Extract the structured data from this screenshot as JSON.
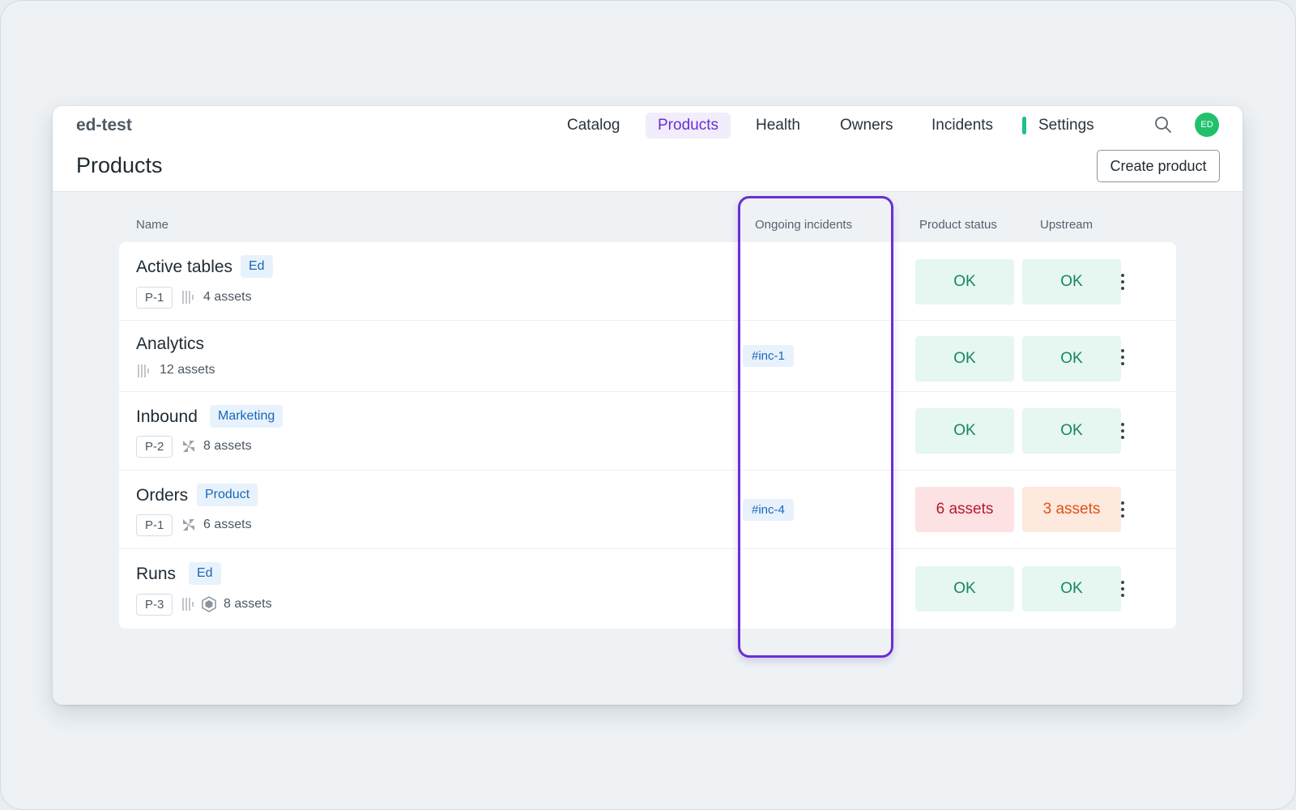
{
  "app": {
    "brand": "ed-test",
    "page_title": "Products"
  },
  "nav": {
    "items": [
      "Catalog",
      "Products",
      "Health",
      "Owners",
      "Incidents",
      "Settings"
    ],
    "active": "Products",
    "settings_indicator_color": "#1fbf8f"
  },
  "user": {
    "initials": "ED",
    "avatar_color": "#22c06b"
  },
  "toolbar": {
    "create_label": "Create product"
  },
  "table": {
    "columns": {
      "name": "Name",
      "incidents": "Ongoing incidents",
      "status": "Product status",
      "upstream": "Upstream"
    },
    "rows": [
      {
        "name": "Active tables",
        "tag": "Ed",
        "code": "P-1",
        "source_icons": [
          "table-icon"
        ],
        "assets": "4 assets",
        "incident": "",
        "status": "OK",
        "status_level": "ok",
        "upstream": "OK",
        "upstream_level": "ok"
      },
      {
        "name": "Analytics",
        "tag": "",
        "code": "",
        "source_icons": [
          "table-icon"
        ],
        "assets": "12 assets",
        "incident": "#inc-1",
        "status": "OK",
        "status_level": "ok",
        "upstream": "OK",
        "upstream_level": "ok"
      },
      {
        "name": "Inbound",
        "tag": "Marketing",
        "code": "P-2",
        "source_icons": [
          "integration-icon"
        ],
        "assets": "8 assets",
        "incident": "",
        "status": "OK",
        "status_level": "ok",
        "upstream": "OK",
        "upstream_level": "ok"
      },
      {
        "name": "Orders",
        "tag": "Product",
        "code": "P-1",
        "source_icons": [
          "integration-icon"
        ],
        "assets": "6 assets",
        "incident": "#inc-4",
        "status": "6 assets",
        "status_level": "error",
        "upstream": "3 assets",
        "upstream_level": "warning"
      },
      {
        "name": "Runs",
        "tag": "Ed",
        "code": "P-3",
        "source_icons": [
          "table-icon",
          "hexagon-icon"
        ],
        "assets": "8 assets",
        "incident": "",
        "status": "OK",
        "status_level": "ok",
        "upstream": "OK",
        "upstream_level": "ok"
      }
    ]
  },
  "colors": {
    "accent": "#6b2ed8",
    "ok_bg": "#e6f6f1",
    "ok_text": "#17875d",
    "error_bg": "#fde2e4",
    "error_text": "#b31b2d",
    "warning_bg": "#fde9dd",
    "warning_text": "#e0501b",
    "highlight_border": "#6a2ed6"
  }
}
